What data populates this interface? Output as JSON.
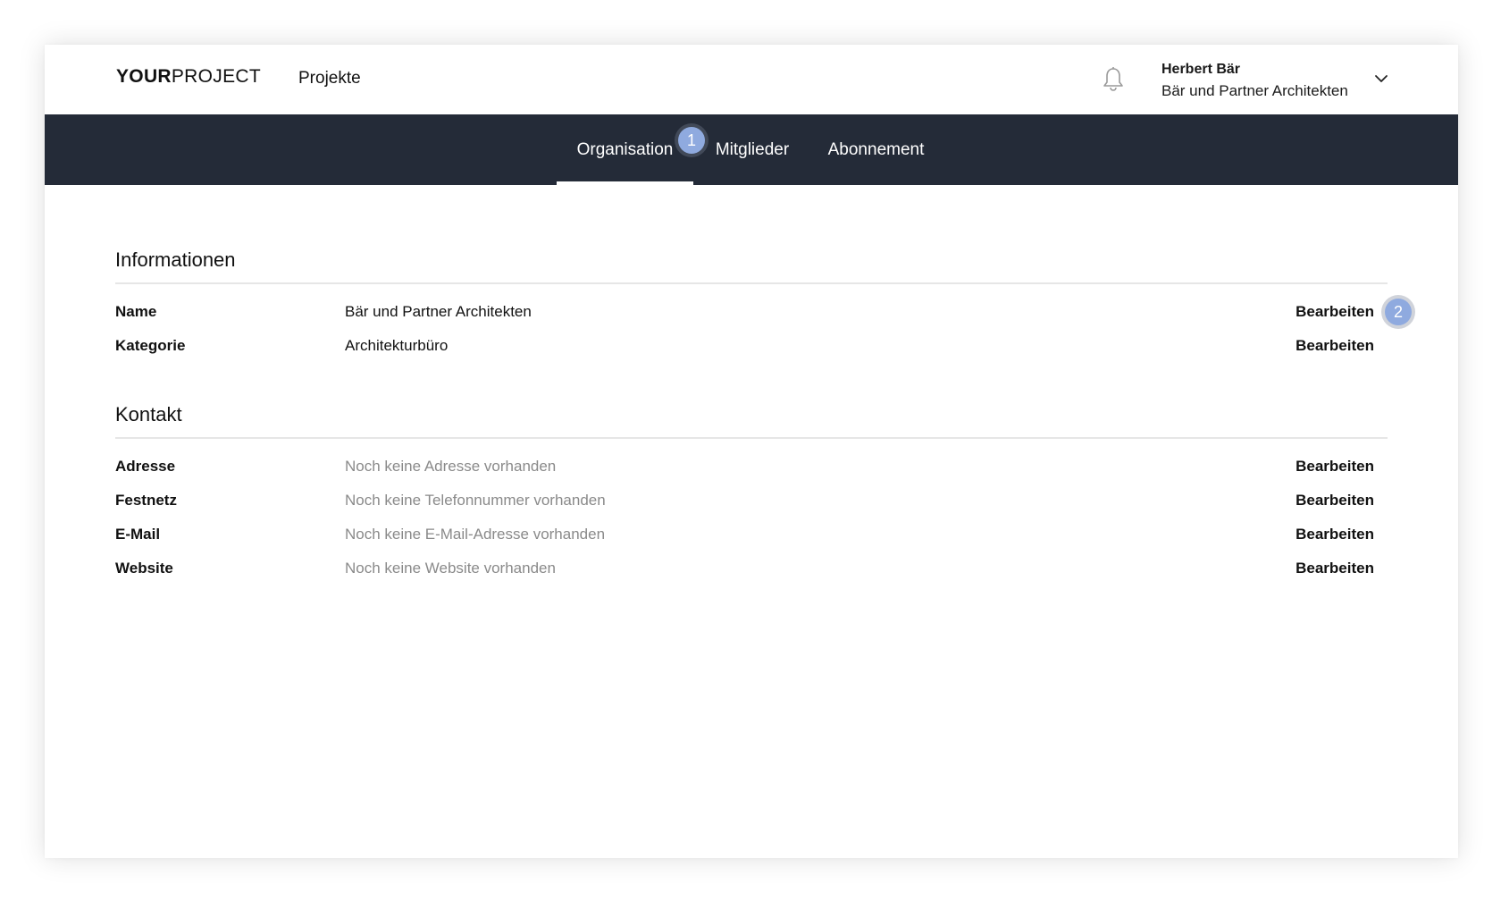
{
  "header": {
    "logo_bold": "YOUR",
    "logo_light": "PROJECT",
    "nav_projects": "Projekte",
    "user_name": "Herbert Bär",
    "user_org": "Bär und Partner Architekten"
  },
  "tabs": [
    {
      "label": "Organisation",
      "active": true
    },
    {
      "label": "Mitglieder",
      "active": false
    },
    {
      "label": "Abonnement",
      "active": false
    }
  ],
  "markers": [
    "1",
    "2"
  ],
  "informationen": {
    "title": "Informationen",
    "rows": [
      {
        "label": "Name",
        "value": "Bär und Partner Architekten",
        "action": "Bearbeiten"
      },
      {
        "label": "Kategorie",
        "value": "Architekturbüro",
        "action": "Bearbeiten"
      }
    ]
  },
  "kontakt": {
    "title": "Kontakt",
    "rows": [
      {
        "label": "Adresse",
        "value": "Noch keine Adresse vorhanden",
        "action": "Bearbeiten"
      },
      {
        "label": "Festnetz",
        "value": "Noch keine Telefonnummer vorhanden",
        "action": "Bearbeiten"
      },
      {
        "label": "E-Mail",
        "value": "Noch keine E-Mail-Adresse vorhanden",
        "action": "Bearbeiten"
      },
      {
        "label": "Website",
        "value": "Noch keine Website vorhanden",
        "action": "Bearbeiten"
      }
    ]
  },
  "colors": {
    "tabbar_bg": "#242b38",
    "marker": "#8faadf",
    "placeholder_text": "#8a8a8a"
  },
  "icons": [
    "bell-icon",
    "chevron-down-icon"
  ]
}
